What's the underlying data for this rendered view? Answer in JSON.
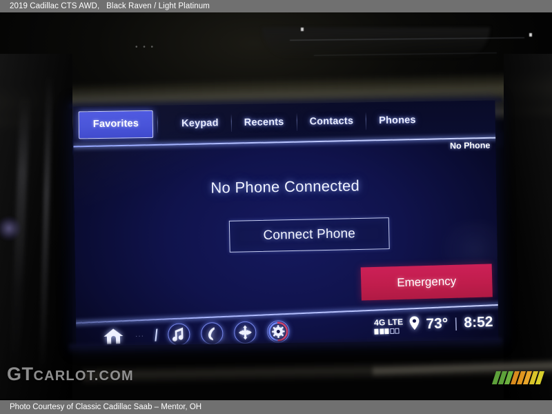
{
  "caption": {
    "vehicle": "2019 Cadillac CTS AWD,",
    "colors": "Black Raven / Light Platinum"
  },
  "footer": {
    "credit": "Photo Courtesy of Classic Cadillac Saab – Mentor, OH"
  },
  "watermark": {
    "prefix": "GT",
    "suffix": "CARLOT.COM"
  },
  "infotainment": {
    "tabs": [
      {
        "label": "Favorites",
        "active": true
      },
      {
        "label": "Keypad",
        "active": false
      },
      {
        "label": "Recents",
        "active": false
      },
      {
        "label": "Contacts",
        "active": false
      },
      {
        "label": "Phones",
        "active": false
      }
    ],
    "phone_status": "No Phone",
    "main_message": "No Phone Connected",
    "connect_button": "Connect Phone",
    "emergency_button": "Emergency",
    "status_bar": {
      "network": "4G LTE",
      "signal_bars_filled": 3,
      "signal_bars_total": 5,
      "temperature": "73°",
      "divider": "|",
      "clock": "8:52"
    },
    "shortcut_icons": [
      {
        "name": "home-icon"
      },
      {
        "name": "music-note-icon"
      },
      {
        "name": "phone-handset-icon"
      },
      {
        "name": "navigation-pad-icon"
      },
      {
        "name": "climate-settings-icon"
      }
    ],
    "dots_marker": "• • •"
  },
  "colors": {
    "caption_bar": "#707070",
    "screen_background": "#10134c",
    "tab_active": "#4450d8",
    "emergency": "#c01d4c",
    "accent_line": "#aab6ff"
  },
  "color_bars": [
    "#5da03a",
    "#5da03a",
    "#6bb03f",
    "#d98b1e",
    "#e0951f",
    "#e8a52a",
    "#d9c42a",
    "#d8cf2c"
  ]
}
